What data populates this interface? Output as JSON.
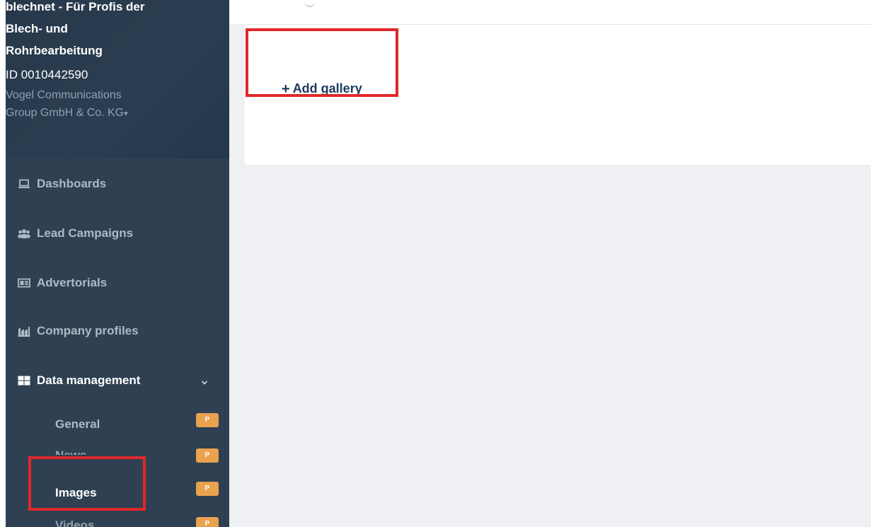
{
  "org": {
    "name": "blechnet - Für Profis der\nBlech- und\nRohrbearbeitung",
    "id": "ID 0010442590",
    "company": "Vogel Communications\nGroup GmbH & Co. KG"
  },
  "nav": {
    "dashboards": "Dashboards",
    "lead_campaigns": "Lead Campaigns",
    "advertorials": "Advertorials",
    "company_profiles": "Company profiles",
    "data_management": "Data management"
  },
  "submenu": {
    "general": "General",
    "news": "News",
    "images": "Images",
    "videos": "Videos",
    "badge": "P"
  },
  "main": {
    "add_gallery": "Add gallery"
  },
  "colors": {
    "sidebar": "#2f4052",
    "badge": "#e9a24d",
    "highlight": "#e0282a",
    "link": "#1c3a5e"
  }
}
